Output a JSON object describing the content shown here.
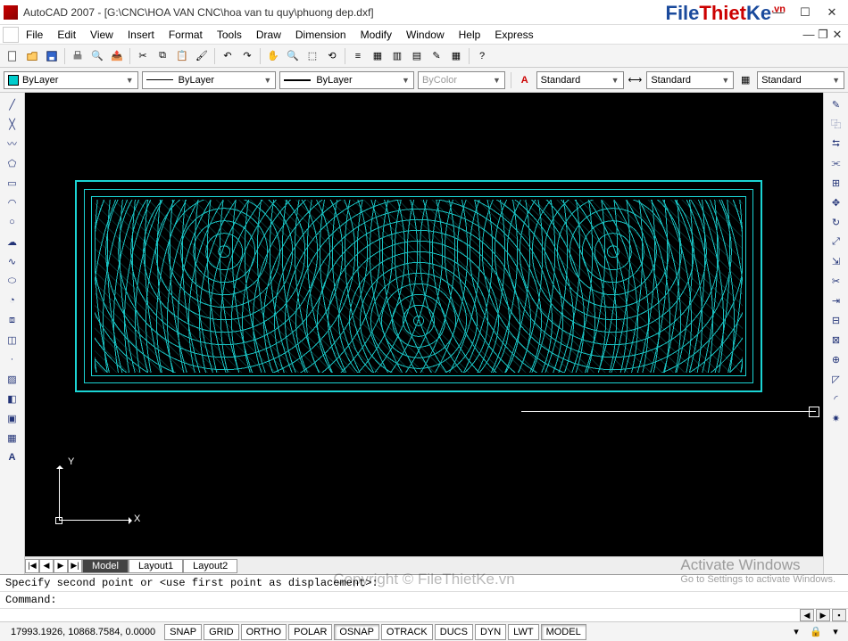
{
  "title": "AutoCAD 2007 - [G:\\CNC\\HOA VAN CNC\\hoa van tu quy\\phuong dep.dxf]",
  "menu": [
    "File",
    "Edit",
    "View",
    "Insert",
    "Format",
    "Tools",
    "Draw",
    "Dimension",
    "Modify",
    "Window",
    "Help",
    "Express"
  ],
  "properties": {
    "layer_combo": "ByLayer",
    "linetype_combo": "ByLayer",
    "lineweight_combo": "ByLayer",
    "color_combo": "ByColor",
    "textstyle": "Standard",
    "dimstyle": "Standard",
    "tablestyle": "Standard"
  },
  "model_tabs": {
    "nav": [
      "|◀",
      "◀",
      "▶",
      "▶|"
    ],
    "tabs": [
      "Model",
      "Layout1",
      "Layout2"
    ],
    "active": 0
  },
  "command": {
    "line1": "Specify second point or <use first point as displacement>:",
    "prompt": "Command:"
  },
  "status": {
    "coords": "17993.1926, 10868.7584, 0.0000",
    "toggles": [
      "SNAP",
      "GRID",
      "ORTHO",
      "POLAR",
      "OSNAP",
      "OTRACK",
      "DUCS",
      "DYN",
      "LWT",
      "MODEL"
    ],
    "inset": [
      "OSNAP",
      "MODEL"
    ]
  },
  "ucs": {
    "x": "X",
    "y": "Y"
  },
  "watermarks": {
    "logo_part1": "File",
    "logo_part2": "Thiet",
    "logo_part3": "Ke",
    "logo_vn": ".vn",
    "center": "Copyright © FileThietKe.vn",
    "activate_title": "Activate Windows",
    "activate_sub": "Go to Settings to activate Windows."
  }
}
